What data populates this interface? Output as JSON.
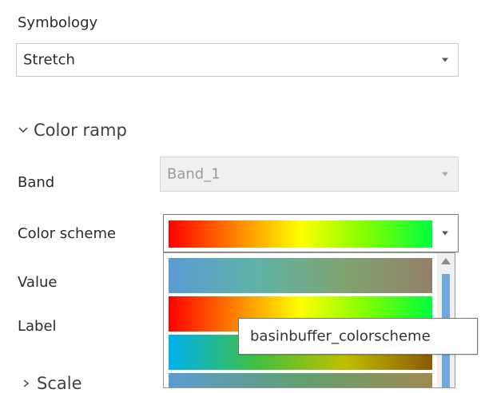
{
  "symbology": {
    "label": "Symbology",
    "value": "Stretch"
  },
  "color_ramp": {
    "section_title": "Color ramp",
    "band": {
      "label": "Band",
      "value": "Band_1"
    },
    "color_scheme": {
      "label": "Color scheme"
    },
    "value_label": "Value",
    "label_label": "Label"
  },
  "ramp_options": [
    {
      "name": "blue-green-brown",
      "colors": [
        "#5b9bd5",
        "#5fb3a8",
        "#7fa36f",
        "#94806a"
      ]
    },
    {
      "name": "red-yellow-green",
      "colors": [
        "#ff0000",
        "#ff8000",
        "#ffff00",
        "#80ff00",
        "#00ff40"
      ]
    },
    {
      "name": "cyan-yellow-brown",
      "colors": [
        "#00b0f0",
        "#40c040",
        "#c0c000",
        "#8a5a00"
      ]
    },
    {
      "name": "blue-green-brown-2",
      "colors": [
        "#5b9bd5",
        "#60a070",
        "#a08a50"
      ]
    }
  ],
  "selected_ramp": {
    "colors": [
      "#ff0000",
      "#ff8000",
      "#ffff00",
      "#80ff00",
      "#00ff40"
    ]
  },
  "tooltip": {
    "text": "basinbuffer_colorscheme"
  },
  "partial_text": "Scale"
}
